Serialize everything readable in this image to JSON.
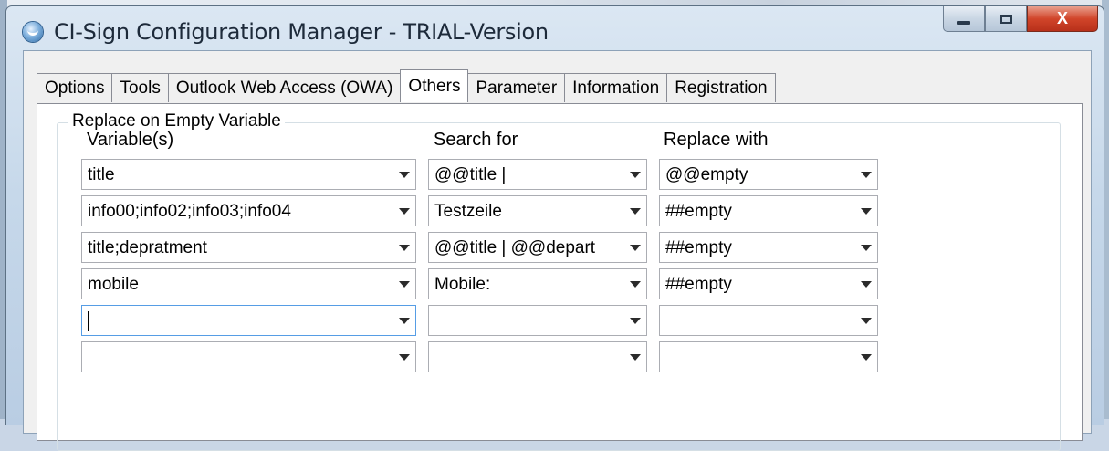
{
  "window": {
    "title": "CI-Sign Configuration Manager - TRIAL-Version"
  },
  "caption": {
    "min_icon": "minimize-icon",
    "max_icon": "maximize-icon",
    "close_label": "X"
  },
  "tabs": [
    {
      "label": "Options"
    },
    {
      "label": "Tools"
    },
    {
      "label": "Outlook Web Access (OWA)"
    },
    {
      "label": "Others",
      "active": true
    },
    {
      "label": "Parameter"
    },
    {
      "label": "Information"
    },
    {
      "label": "Registration"
    }
  ],
  "group": {
    "title": "Replace on Empty Variable",
    "columns": {
      "variables": "Variable(s)",
      "search": "Search for",
      "replace": "Replace with"
    },
    "rows": [
      {
        "variables": "title",
        "search": "@@title |",
        "replace": "@@empty"
      },
      {
        "variables": "info00;info02;info03;info04",
        "search": "Testzeile",
        "replace": "##empty"
      },
      {
        "variables": "title;depratment",
        "search": "@@title | @@depart",
        "replace": "##empty"
      },
      {
        "variables": "mobile",
        "search": "Mobile:",
        "replace": "##empty"
      },
      {
        "variables": "",
        "search": "",
        "replace": ""
      },
      {
        "variables": "",
        "search": "",
        "replace": ""
      }
    ]
  },
  "colors": {
    "accent_focus": "#569de5",
    "close_red": "#d1452a"
  }
}
